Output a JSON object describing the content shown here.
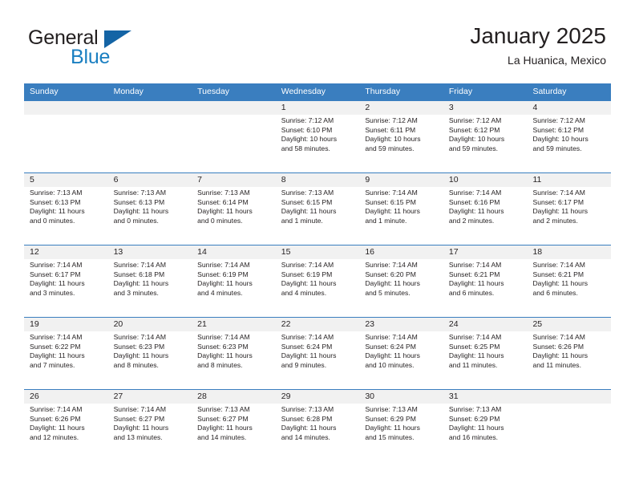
{
  "brand": {
    "name_part1": "General",
    "name_part2": "Blue"
  },
  "header": {
    "title": "January 2025",
    "location": "La Huanica, Mexico"
  },
  "colors": {
    "header_blue": "#3a7ebf",
    "brand_blue": "#1a7fc1",
    "triangle_blue": "#1464a5",
    "date_band": "#f1f1f1",
    "text": "#231f20"
  },
  "weekdays": [
    "Sunday",
    "Monday",
    "Tuesday",
    "Wednesday",
    "Thursday",
    "Friday",
    "Saturday"
  ],
  "labels": {
    "sunrise": "Sunrise:",
    "sunset": "Sunset:",
    "daylight": "Daylight:"
  },
  "weeks": [
    [
      {
        "day": "",
        "sunrise": "",
        "sunset": "",
        "daylight_line1": "",
        "daylight_line2": ""
      },
      {
        "day": "",
        "sunrise": "",
        "sunset": "",
        "daylight_line1": "",
        "daylight_line2": ""
      },
      {
        "day": "",
        "sunrise": "",
        "sunset": "",
        "daylight_line1": "",
        "daylight_line2": ""
      },
      {
        "day": "1",
        "sunrise": "Sunrise: 7:12 AM",
        "sunset": "Sunset: 6:10 PM",
        "daylight_line1": "Daylight: 10 hours",
        "daylight_line2": "and 58 minutes."
      },
      {
        "day": "2",
        "sunrise": "Sunrise: 7:12 AM",
        "sunset": "Sunset: 6:11 PM",
        "daylight_line1": "Daylight: 10 hours",
        "daylight_line2": "and 59 minutes."
      },
      {
        "day": "3",
        "sunrise": "Sunrise: 7:12 AM",
        "sunset": "Sunset: 6:12 PM",
        "daylight_line1": "Daylight: 10 hours",
        "daylight_line2": "and 59 minutes."
      },
      {
        "day": "4",
        "sunrise": "Sunrise: 7:12 AM",
        "sunset": "Sunset: 6:12 PM",
        "daylight_line1": "Daylight: 10 hours",
        "daylight_line2": "and 59 minutes."
      }
    ],
    [
      {
        "day": "5",
        "sunrise": "Sunrise: 7:13 AM",
        "sunset": "Sunset: 6:13 PM",
        "daylight_line1": "Daylight: 11 hours",
        "daylight_line2": "and 0 minutes."
      },
      {
        "day": "6",
        "sunrise": "Sunrise: 7:13 AM",
        "sunset": "Sunset: 6:13 PM",
        "daylight_line1": "Daylight: 11 hours",
        "daylight_line2": "and 0 minutes."
      },
      {
        "day": "7",
        "sunrise": "Sunrise: 7:13 AM",
        "sunset": "Sunset: 6:14 PM",
        "daylight_line1": "Daylight: 11 hours",
        "daylight_line2": "and 0 minutes."
      },
      {
        "day": "8",
        "sunrise": "Sunrise: 7:13 AM",
        "sunset": "Sunset: 6:15 PM",
        "daylight_line1": "Daylight: 11 hours",
        "daylight_line2": "and 1 minute."
      },
      {
        "day": "9",
        "sunrise": "Sunrise: 7:14 AM",
        "sunset": "Sunset: 6:15 PM",
        "daylight_line1": "Daylight: 11 hours",
        "daylight_line2": "and 1 minute."
      },
      {
        "day": "10",
        "sunrise": "Sunrise: 7:14 AM",
        "sunset": "Sunset: 6:16 PM",
        "daylight_line1": "Daylight: 11 hours",
        "daylight_line2": "and 2 minutes."
      },
      {
        "day": "11",
        "sunrise": "Sunrise: 7:14 AM",
        "sunset": "Sunset: 6:17 PM",
        "daylight_line1": "Daylight: 11 hours",
        "daylight_line2": "and 2 minutes."
      }
    ],
    [
      {
        "day": "12",
        "sunrise": "Sunrise: 7:14 AM",
        "sunset": "Sunset: 6:17 PM",
        "daylight_line1": "Daylight: 11 hours",
        "daylight_line2": "and 3 minutes."
      },
      {
        "day": "13",
        "sunrise": "Sunrise: 7:14 AM",
        "sunset": "Sunset: 6:18 PM",
        "daylight_line1": "Daylight: 11 hours",
        "daylight_line2": "and 3 minutes."
      },
      {
        "day": "14",
        "sunrise": "Sunrise: 7:14 AM",
        "sunset": "Sunset: 6:19 PM",
        "daylight_line1": "Daylight: 11 hours",
        "daylight_line2": "and 4 minutes."
      },
      {
        "day": "15",
        "sunrise": "Sunrise: 7:14 AM",
        "sunset": "Sunset: 6:19 PM",
        "daylight_line1": "Daylight: 11 hours",
        "daylight_line2": "and 4 minutes."
      },
      {
        "day": "16",
        "sunrise": "Sunrise: 7:14 AM",
        "sunset": "Sunset: 6:20 PM",
        "daylight_line1": "Daylight: 11 hours",
        "daylight_line2": "and 5 minutes."
      },
      {
        "day": "17",
        "sunrise": "Sunrise: 7:14 AM",
        "sunset": "Sunset: 6:21 PM",
        "daylight_line1": "Daylight: 11 hours",
        "daylight_line2": "and 6 minutes."
      },
      {
        "day": "18",
        "sunrise": "Sunrise: 7:14 AM",
        "sunset": "Sunset: 6:21 PM",
        "daylight_line1": "Daylight: 11 hours",
        "daylight_line2": "and 6 minutes."
      }
    ],
    [
      {
        "day": "19",
        "sunrise": "Sunrise: 7:14 AM",
        "sunset": "Sunset: 6:22 PM",
        "daylight_line1": "Daylight: 11 hours",
        "daylight_line2": "and 7 minutes."
      },
      {
        "day": "20",
        "sunrise": "Sunrise: 7:14 AM",
        "sunset": "Sunset: 6:23 PM",
        "daylight_line1": "Daylight: 11 hours",
        "daylight_line2": "and 8 minutes."
      },
      {
        "day": "21",
        "sunrise": "Sunrise: 7:14 AM",
        "sunset": "Sunset: 6:23 PM",
        "daylight_line1": "Daylight: 11 hours",
        "daylight_line2": "and 8 minutes."
      },
      {
        "day": "22",
        "sunrise": "Sunrise: 7:14 AM",
        "sunset": "Sunset: 6:24 PM",
        "daylight_line1": "Daylight: 11 hours",
        "daylight_line2": "and 9 minutes."
      },
      {
        "day": "23",
        "sunrise": "Sunrise: 7:14 AM",
        "sunset": "Sunset: 6:24 PM",
        "daylight_line1": "Daylight: 11 hours",
        "daylight_line2": "and 10 minutes."
      },
      {
        "day": "24",
        "sunrise": "Sunrise: 7:14 AM",
        "sunset": "Sunset: 6:25 PM",
        "daylight_line1": "Daylight: 11 hours",
        "daylight_line2": "and 11 minutes."
      },
      {
        "day": "25",
        "sunrise": "Sunrise: 7:14 AM",
        "sunset": "Sunset: 6:26 PM",
        "daylight_line1": "Daylight: 11 hours",
        "daylight_line2": "and 11 minutes."
      }
    ],
    [
      {
        "day": "26",
        "sunrise": "Sunrise: 7:14 AM",
        "sunset": "Sunset: 6:26 PM",
        "daylight_line1": "Daylight: 11 hours",
        "daylight_line2": "and 12 minutes."
      },
      {
        "day": "27",
        "sunrise": "Sunrise: 7:14 AM",
        "sunset": "Sunset: 6:27 PM",
        "daylight_line1": "Daylight: 11 hours",
        "daylight_line2": "and 13 minutes."
      },
      {
        "day": "28",
        "sunrise": "Sunrise: 7:13 AM",
        "sunset": "Sunset: 6:27 PM",
        "daylight_line1": "Daylight: 11 hours",
        "daylight_line2": "and 14 minutes."
      },
      {
        "day": "29",
        "sunrise": "Sunrise: 7:13 AM",
        "sunset": "Sunset: 6:28 PM",
        "daylight_line1": "Daylight: 11 hours",
        "daylight_line2": "and 14 minutes."
      },
      {
        "day": "30",
        "sunrise": "Sunrise: 7:13 AM",
        "sunset": "Sunset: 6:29 PM",
        "daylight_line1": "Daylight: 11 hours",
        "daylight_line2": "and 15 minutes."
      },
      {
        "day": "31",
        "sunrise": "Sunrise: 7:13 AM",
        "sunset": "Sunset: 6:29 PM",
        "daylight_line1": "Daylight: 11 hours",
        "daylight_line2": "and 16 minutes."
      },
      {
        "day": "",
        "sunrise": "",
        "sunset": "",
        "daylight_line1": "",
        "daylight_line2": ""
      }
    ]
  ]
}
